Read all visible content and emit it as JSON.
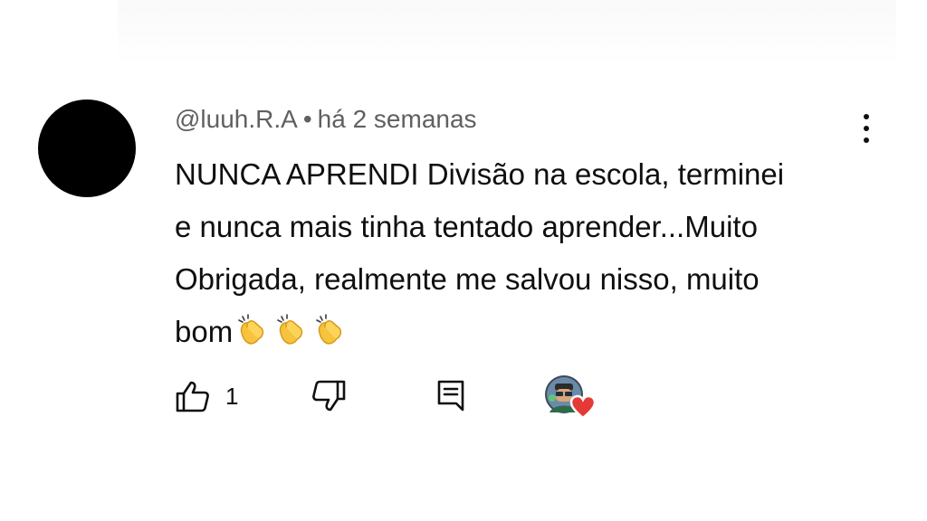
{
  "comment": {
    "author": "@luuh.R.A",
    "separator": "•",
    "time": "há 2 semanas",
    "text_lines": [
      "NUNCA APRENDI Divisão na escola, terminei",
      "e nunca mais tinha tentado aprender...Muito",
      "Obrigada, realmente me salvou nisso, muito",
      "bom"
    ],
    "emoji": "clapping-hands",
    "emoji_count": 3,
    "like_count": "1"
  },
  "icons": {
    "like": "thumb-up-icon",
    "dislike": "thumb-down-icon",
    "reply": "reply-comment-icon",
    "more": "more-vertical-icon",
    "creator_heart": "creator-heart-icon"
  },
  "colors": {
    "text": "#0f0f0f",
    "meta": "#606060",
    "heart": "#e53935",
    "avatar": "#000000"
  }
}
